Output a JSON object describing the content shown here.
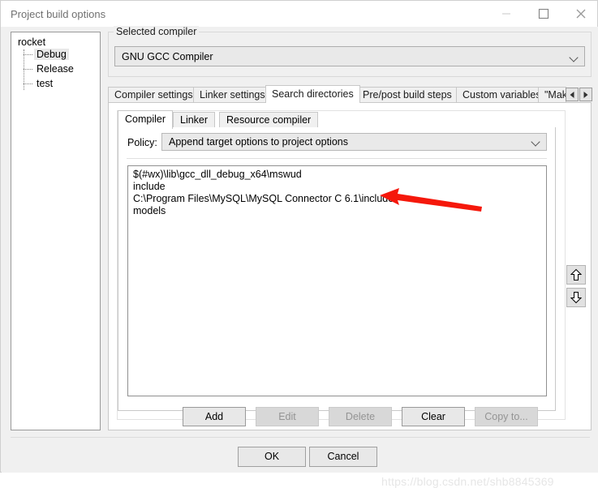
{
  "window": {
    "title": "Project build options",
    "controls": {
      "minimize": "minimize-icon",
      "maximize": "maximize-icon",
      "close": "close-icon"
    }
  },
  "tree": {
    "root": "rocket",
    "children": [
      {
        "label": "Debug",
        "selected": true
      },
      {
        "label": "Release",
        "selected": false
      },
      {
        "label": "test",
        "selected": false
      }
    ]
  },
  "compiler_group": {
    "label": "Selected compiler",
    "selected": "GNU GCC Compiler",
    "chevron": "chevron-down-icon"
  },
  "outer_tabs": {
    "items": [
      {
        "label": "Compiler settings",
        "active": false
      },
      {
        "label": "Linker settings",
        "active": false
      },
      {
        "label": "Search directories",
        "active": true
      },
      {
        "label": "Pre/post build steps",
        "active": false
      },
      {
        "label": "Custom variables",
        "active": false
      },
      {
        "label": "\"Mak",
        "active": false
      }
    ],
    "scroll_left": "scroll-left-icon",
    "scroll_right": "scroll-right-icon"
  },
  "inner_tabs": {
    "items": [
      {
        "label": "Compiler",
        "active": true
      },
      {
        "label": "Linker",
        "active": false
      },
      {
        "label": "Resource compiler",
        "active": false
      }
    ]
  },
  "policy": {
    "label": "Policy:",
    "value": "Append target options to project options",
    "chevron": "chevron-down-icon"
  },
  "directories": [
    "$(#wx)\\lib\\gcc_dll_debug_x64\\mswud",
    "include",
    "C:\\Program Files\\MySQL\\MySQL Connector C 6.1\\include",
    "models"
  ],
  "move_buttons": {
    "up": "arrow-up-icon",
    "down": "arrow-down-icon"
  },
  "action_buttons": [
    {
      "label": "Add",
      "enabled": true
    },
    {
      "label": "Edit",
      "enabled": false
    },
    {
      "label": "Delete",
      "enabled": false
    },
    {
      "label": "Clear",
      "enabled": true
    },
    {
      "label": "Copy to...",
      "enabled": false
    }
  ],
  "dialog_buttons": {
    "ok": "OK",
    "cancel": "Cancel"
  },
  "annotation": {
    "arrow_color": "#f5180b",
    "points_at": "C:\\Program Files\\MySQL\\MySQL Connector C 6.1\\include"
  },
  "watermark": "https://blog.csdn.net/shb8845369"
}
